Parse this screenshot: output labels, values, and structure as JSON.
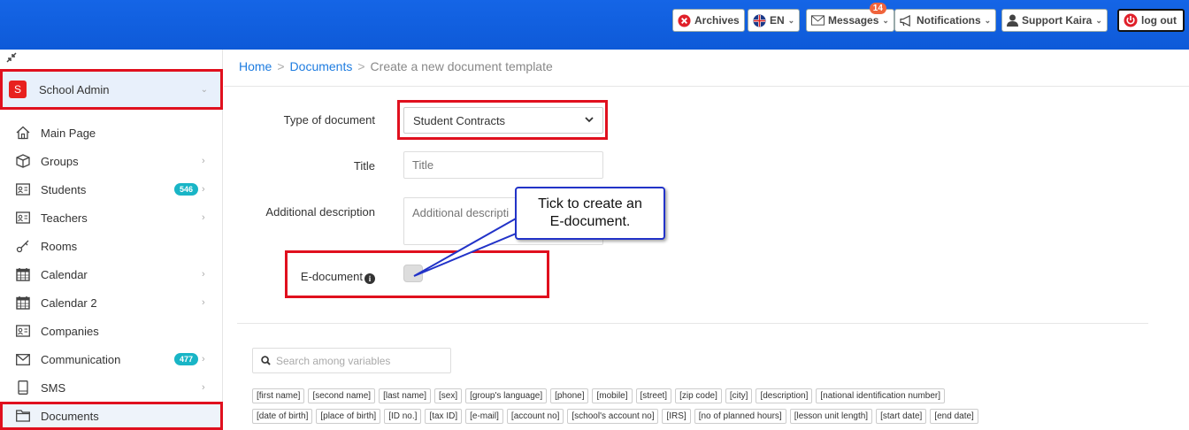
{
  "topbar": {
    "archives": "Archives",
    "language": "EN",
    "messages": "Messages",
    "messages_badge": "14",
    "notifications": "Notifications",
    "user": "Support Kaira",
    "logout": "log out"
  },
  "sidebar": {
    "school": {
      "initial": "S",
      "label": "School Admin"
    },
    "items": [
      {
        "label": "Main Page",
        "icon": "home-icon",
        "badge": "",
        "arrow": false
      },
      {
        "label": "Groups",
        "icon": "cube-icon",
        "badge": "",
        "arrow": true
      },
      {
        "label": "Students",
        "icon": "id-card-icon",
        "badge": "546",
        "arrow": true
      },
      {
        "label": "Teachers",
        "icon": "id-card-icon",
        "badge": "",
        "arrow": true
      },
      {
        "label": "Rooms",
        "icon": "key-icon",
        "badge": "",
        "arrow": false
      },
      {
        "label": "Calendar",
        "icon": "calendar-icon",
        "badge": "",
        "arrow": true
      },
      {
        "label": "Calendar 2",
        "icon": "calendar-icon",
        "badge": "",
        "arrow": true
      },
      {
        "label": "Companies",
        "icon": "id-card-icon",
        "badge": "",
        "arrow": false
      },
      {
        "label": "Communication",
        "icon": "envelope-icon",
        "badge": "477",
        "arrow": true
      },
      {
        "label": "SMS",
        "icon": "phone-icon",
        "badge": "",
        "arrow": true
      },
      {
        "label": "Documents",
        "icon": "folder-icon",
        "badge": "",
        "arrow": false
      }
    ]
  },
  "breadcrumb": {
    "home": "Home",
    "documents": "Documents",
    "current": "Create a new document template"
  },
  "form": {
    "type_label": "Type of document",
    "type_value": "Student Contracts",
    "title_label": "Title",
    "title_placeholder": "Title",
    "desc_label": "Additional description",
    "desc_placeholder": "Additional descripti",
    "edoc_label": "E-document"
  },
  "callout": {
    "line1": "Tick to create an",
    "line2": "E-document."
  },
  "variables": {
    "search_placeholder": "Search among variables",
    "row1": [
      "[first name]",
      "[second name]",
      "[last name]",
      "[sex]",
      "[group's language]",
      "[phone]",
      "[mobile]",
      "[street]",
      "[zip code]",
      "[city]",
      "[description]",
      "[national identification number]"
    ],
    "row2": [
      "[date of birth]",
      "[place of birth]",
      "[ID no.]",
      "[tax ID]",
      "[e-mail]",
      "[account no]",
      "[school's account no]",
      "[IRS]",
      "[no of planned hours]",
      "[lesson unit length]",
      "[start date]",
      "[end date]"
    ]
  },
  "colors": {
    "topbar": "#1565e6",
    "highlight": "#e0101e",
    "link": "#1e7ce0",
    "badge": "#19b5c6",
    "callout_border": "#2233c8"
  }
}
